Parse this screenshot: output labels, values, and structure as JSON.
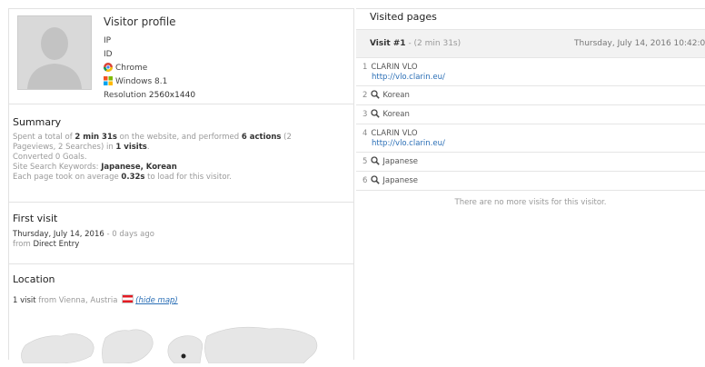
{
  "profile": {
    "title": "Visitor profile",
    "ip_label": "IP",
    "id_label": "ID",
    "browser": "Chrome",
    "os": "Windows 8.1",
    "resolution_label": "Resolution",
    "resolution": "2560x1440"
  },
  "summary": {
    "title": "Summary",
    "l1": {
      "a": "Spent a total of ",
      "b": "2 min 31s",
      "c": " on the website, and performed ",
      "d": "6 actions",
      "e": " (2"
    },
    "l2": {
      "a": "Pageviews, 2 Searches) in ",
      "b": "1 visits",
      "c": "."
    },
    "l3": "Converted 0 Goals.",
    "l4": {
      "a": "Site Search Keywords: ",
      "b": "Japanese, Korean"
    },
    "l5": {
      "a": "Each page took on average ",
      "b": "0.32s",
      "c": " to load for this visitor."
    }
  },
  "first_visit": {
    "title": "First visit",
    "date": "Thursday, July 14, 2016",
    "ago": " - 0 days ago",
    "from_label": "from ",
    "source": "Direct Entry"
  },
  "location": {
    "title": "Location",
    "count": "1 visit",
    "from": " from Vienna, Austria ",
    "hide_map": "(hide map)"
  },
  "visited_pages": {
    "title": "Visited pages",
    "visit_label": "Visit #1",
    "visit_duration": " - (2 min 31s)",
    "visit_date": "Thursday, July 14, 2016 10:42:0",
    "actions": [
      {
        "num": "1",
        "title": "CLARIN VLO",
        "url": "http://vlo.clarin.eu/"
      },
      {
        "num": "2",
        "title": "Korean"
      },
      {
        "num": "3",
        "title": "Korean"
      },
      {
        "num": "4",
        "title": "CLARIN VLO",
        "url": "http://vlo.clarin.eu/"
      },
      {
        "num": "5",
        "title": "Japanese"
      },
      {
        "num": "6",
        "title": "Japanese"
      }
    ],
    "no_more": "There are no more visits for this visitor."
  },
  "colors": {
    "link": "#2b6fb6",
    "muted": "#999999",
    "header_bg": "#f2f2f2"
  },
  "icons": [
    "avatar-silhouette",
    "chrome-icon",
    "windows-icon",
    "search-icon",
    "austria-flag-icon",
    "world-map"
  ]
}
